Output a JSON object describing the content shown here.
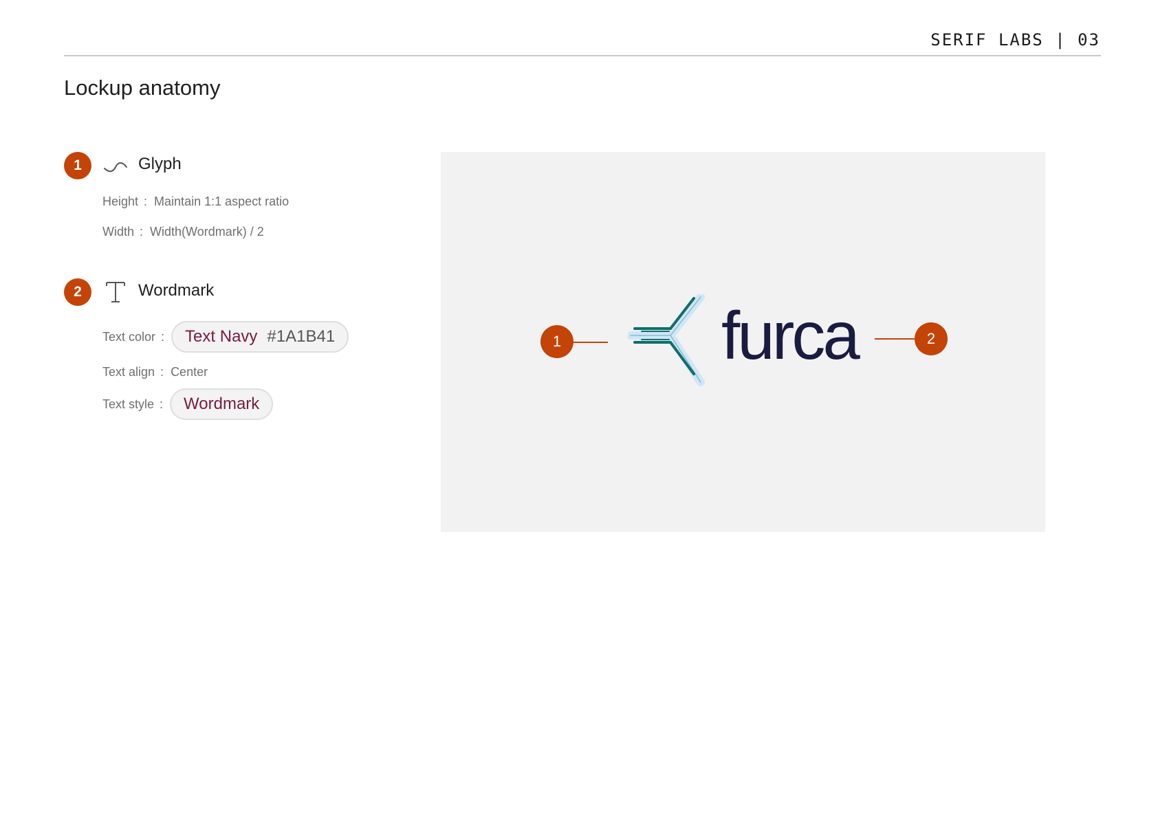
{
  "header": {
    "brand": "SERIF LABS | 03"
  },
  "page": {
    "title": "Lockup anatomy"
  },
  "sections": [
    {
      "number": "1",
      "icon": "wave-icon",
      "title": "Glyph",
      "props": [
        {
          "label": "Height",
          "value": "Maintain 1:1 aspect ratio"
        },
        {
          "label": "Width",
          "value": "Width(Wordmark) / 2"
        }
      ]
    },
    {
      "number": "2",
      "icon": "text-icon",
      "title": "Wordmark",
      "props": [
        {
          "label": "Text color",
          "value_name": "Text Navy",
          "value_hex": "#1A1B41"
        },
        {
          "label": "Text align",
          "value": "Center"
        },
        {
          "label": "Text style",
          "value": "Wordmark"
        }
      ]
    }
  ],
  "preview": {
    "callout_1": "1",
    "callout_2": "2",
    "wordmark": "furca"
  },
  "colors": {
    "accent": "#C44306",
    "text_navy": "#1A1B41",
    "pill_text": "#7A1B3F",
    "glyph_teal": "#0F6E6A",
    "glyph_light": "#CFE6F5",
    "preview_bg": "#F2F2F2"
  }
}
